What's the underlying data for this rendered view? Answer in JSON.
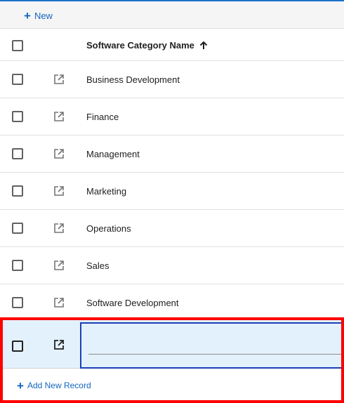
{
  "toolbar": {
    "new_label": "New",
    "plus_icon": "+"
  },
  "grid": {
    "column_header": "Software Category Name",
    "sort_icon": "arrow-up-icon",
    "rows": [
      "Business Development",
      "Finance",
      "Management",
      "Marketing",
      "Operations",
      "Sales",
      "Software Development"
    ]
  },
  "new_row": {
    "value": "",
    "add_label": "Add New Record",
    "plus_icon": "+"
  },
  "colors": {
    "accent": "#1565c0",
    "edit_row_bg": "#e3f1fc",
    "edit_border": "#1a3fb8",
    "highlight": "#ff0000"
  }
}
